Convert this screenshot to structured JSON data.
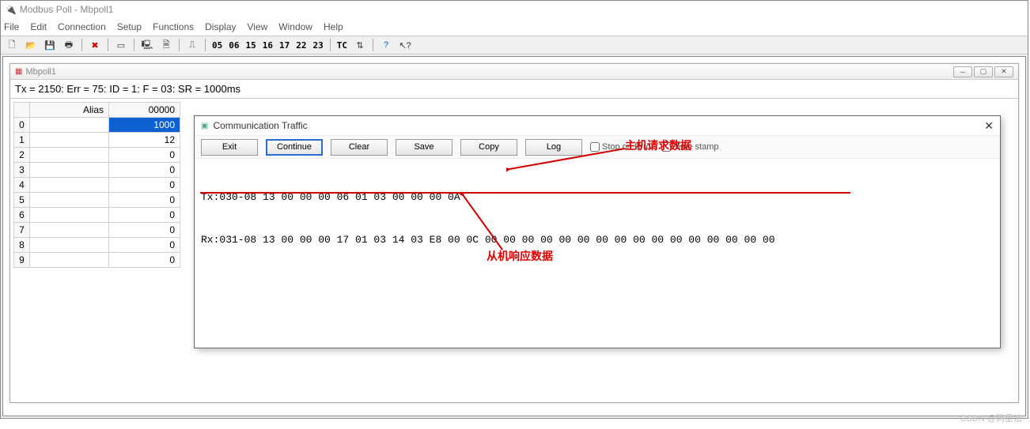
{
  "app": {
    "title": "Modbus Poll - Mbpoll1"
  },
  "menu": [
    "File",
    "Edit",
    "Connection",
    "Setup",
    "Functions",
    "Display",
    "View",
    "Window",
    "Help"
  ],
  "toolbar_codes": [
    "05",
    "06",
    "15",
    "16",
    "17",
    "22",
    "23"
  ],
  "toolbar_tc": "TC",
  "child": {
    "title": "Mbpoll1",
    "status": "Tx = 2150: Err = 75: ID = 1: F = 03: SR = 1000ms",
    "headers": {
      "alias": "Alias",
      "reg": "00000"
    },
    "rows": [
      {
        "idx": "0",
        "alias": "",
        "val": "1000",
        "selected": true
      },
      {
        "idx": "1",
        "alias": "",
        "val": "12"
      },
      {
        "idx": "2",
        "alias": "",
        "val": "0"
      },
      {
        "idx": "3",
        "alias": "",
        "val": "0"
      },
      {
        "idx": "4",
        "alias": "",
        "val": "0"
      },
      {
        "idx": "5",
        "alias": "",
        "val": "0"
      },
      {
        "idx": "6",
        "alias": "",
        "val": "0"
      },
      {
        "idx": "7",
        "alias": "",
        "val": "0"
      },
      {
        "idx": "8",
        "alias": "",
        "val": "0"
      },
      {
        "idx": "9",
        "alias": "",
        "val": "0"
      }
    ]
  },
  "comm": {
    "title": "Communication Traffic",
    "buttons": {
      "exit": "Exit",
      "continue": "Continue",
      "clear": "Clear",
      "save": "Save",
      "copy": "Copy",
      "log": "Log"
    },
    "checks": {
      "stop": "Stop on Error",
      "time": "Time stamp"
    },
    "tx": "Tx:030-08 13 00 00 00 06 01 03 00 00 00 0A",
    "rx": "Rx:031-08 13 00 00 00 17 01 03 14 03 E8 00 0C 00 00 00 00 00 00 00 00 00 00 00 00 00 00 00 00"
  },
  "annotations": {
    "req": "主机请求数据",
    "resp": "从机响应数据"
  },
  "watermark": "CSDN @码里法"
}
